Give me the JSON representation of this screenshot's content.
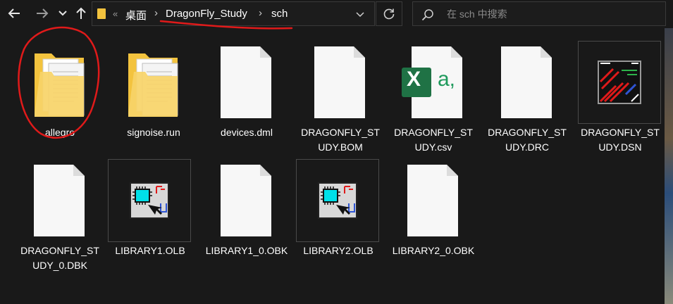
{
  "toolbar": {
    "back_icon": "arrow-left-icon",
    "forward_icon": "arrow-right-icon",
    "recent_icon": "chevron-down-icon",
    "up_icon": "arrow-up-icon"
  },
  "address": {
    "overflow": "«",
    "segments": [
      "桌面",
      "DragonFly_Study",
      "sch"
    ]
  },
  "search": {
    "placeholder": "在 sch 中搜索"
  },
  "files": [
    {
      "name": "allegro",
      "type": "folder-files"
    },
    {
      "name": "signoise.run",
      "type": "folder-files"
    },
    {
      "name": "devices.dml",
      "type": "blank"
    },
    {
      "name": "DRAGONFLY_STUDY.BOM",
      "type": "blank"
    },
    {
      "name": "DRAGONFLY_STUDY.csv",
      "type": "excel",
      "badge": "X",
      "suffix": "a,"
    },
    {
      "name": "DRAGONFLY_STUDY.DRC",
      "type": "blank"
    },
    {
      "name": "DRAGONFLY_STUDY.DSN",
      "type": "dsn"
    },
    {
      "name": "DRAGONFLY_STUDY_0.DBK",
      "type": "blank"
    },
    {
      "name": "LIBRARY1.OLB",
      "type": "olb"
    },
    {
      "name": "LIBRARY1_0.OBK",
      "type": "blank"
    },
    {
      "name": "LIBRARY2.OLB",
      "type": "olb"
    },
    {
      "name": "LIBRARY2_0.OBK",
      "type": "blank"
    }
  ],
  "colors": {
    "background": "#191919",
    "annotation": "#e01a1a",
    "folder": "#f3c33e",
    "excel": "#1f7245"
  }
}
